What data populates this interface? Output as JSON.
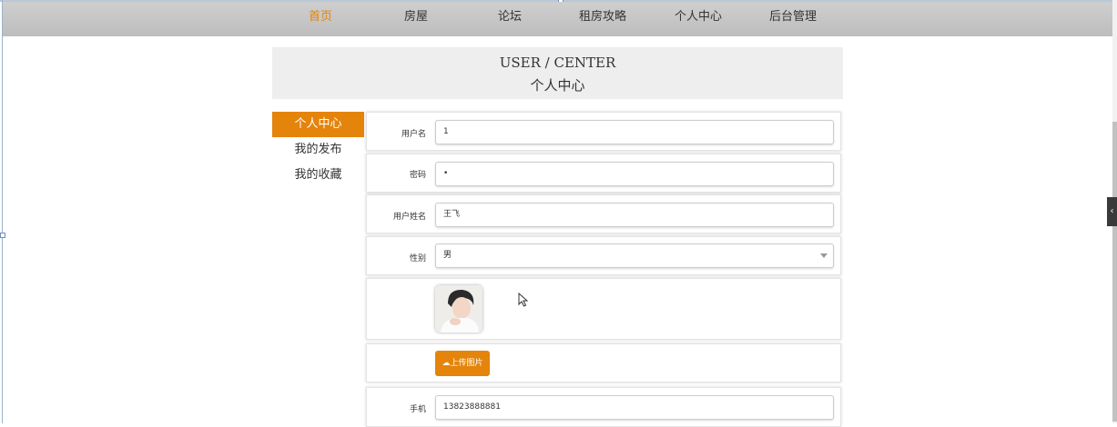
{
  "nav": {
    "items": [
      {
        "label": "首页",
        "active": true
      },
      {
        "label": "房屋",
        "active": false
      },
      {
        "label": "论坛",
        "active": false
      },
      {
        "label": "租房攻略",
        "active": false
      },
      {
        "label": "个人中心",
        "active": false
      },
      {
        "label": "后台管理",
        "active": false
      }
    ]
  },
  "heading": {
    "en": "USER / CENTER",
    "cn": "个人中心"
  },
  "menu": {
    "items": [
      {
        "label": "个人中心",
        "active": true
      },
      {
        "label": "我的发布",
        "active": false
      },
      {
        "label": "我的收藏",
        "active": false
      }
    ]
  },
  "form": {
    "username_label": "用户名",
    "username_value": "1",
    "password_label": "密码",
    "password_value": "•",
    "realname_label": "用户姓名",
    "realname_value": "王飞",
    "gender_label": "性别",
    "gender_value": "男",
    "upload_label": "上传图片",
    "phone_label": "手机",
    "phone_value": "13823888881"
  },
  "colors": {
    "accent": "#e4840b",
    "nav_bg": "#c6c6c6"
  },
  "icons": {
    "upload": "cloud-upload-icon",
    "select": "chevron-down-icon",
    "sidebar_toggle": "chevron-left-icon"
  }
}
